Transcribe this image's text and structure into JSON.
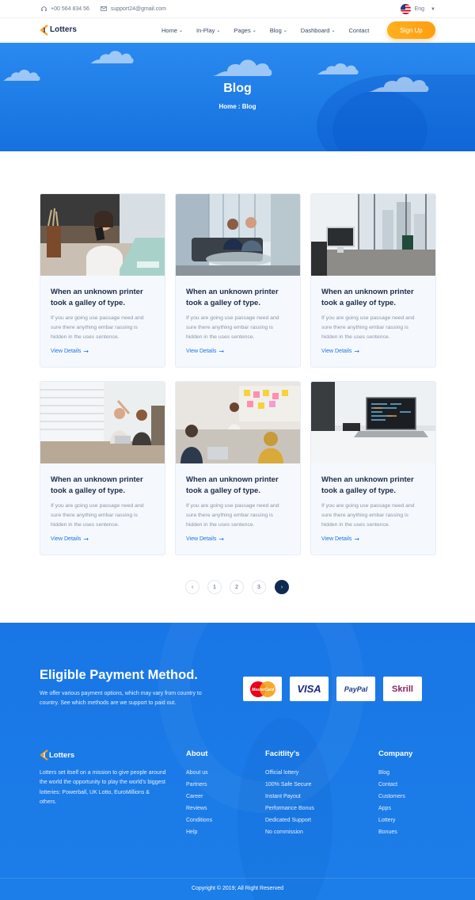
{
  "topbar": {
    "phone": "+00 564 834 56",
    "email": "support24@gmail.com",
    "language": "Eng"
  },
  "header": {
    "brand": "Lotters",
    "menu": [
      {
        "label": "Home",
        "dropdown": true
      },
      {
        "label": "In-Play",
        "dropdown": true
      },
      {
        "label": "Pages",
        "dropdown": true
      },
      {
        "label": "Blog",
        "dropdown": true
      },
      {
        "label": "Dashboard",
        "dropdown": true
      },
      {
        "label": "Contact",
        "dropdown": false
      }
    ],
    "signup_label": "Sign Up",
    "accent": "#fd9e12"
  },
  "hero": {
    "title": "Blog",
    "breadcrumb": "Home : Blog"
  },
  "posts": [
    {
      "title": "When an unknown printer took a galley of type.",
      "excerpt": "If you are going use passage need and sure there anything embar rassing is hidden in the uses sentence.",
      "link": "View Details",
      "image": "woman-phone-laptop"
    },
    {
      "title": "When an unknown printer took a galley of type.",
      "excerpt": "If you are going use passage need and sure there anything embar rassing is hidden in the uses sentence.",
      "link": "View Details",
      "image": "men-meeting-sofa"
    },
    {
      "title": "When an unknown printer took a galley of type.",
      "excerpt": "If you are going use passage need and sure there anything embar rassing is hidden in the uses sentence.",
      "link": "View Details",
      "image": "office-desk-imac"
    },
    {
      "title": "When an unknown printer took a galley of type.",
      "excerpt": "If you are going use passage need and sure there anything embar rassing is hidden in the uses sentence.",
      "link": "View Details",
      "image": "women-floor-laptop"
    },
    {
      "title": "When an unknown printer took a galley of type.",
      "excerpt": "If you are going use passage need and sure there anything embar rassing is hidden in the uses sentence.",
      "link": "View Details",
      "image": "team-sticky-notes"
    },
    {
      "title": "When an unknown printer took a galley of type.",
      "excerpt": "If you are going use passage need and sure there anything embar rassing is hidden in the uses sentence.",
      "link": "View Details",
      "image": "laptop-code-desk"
    }
  ],
  "pagination": {
    "prev": "‹",
    "pages": [
      "1",
      "2",
      "3"
    ],
    "next": "›"
  },
  "footer": {
    "payment_title": "Eligible Payment Method.",
    "payment_desc": "We offer various payment options, which may vary from country to country. See which methods are we support to paid out.",
    "payment_methods": [
      "MasterCard",
      "VISA",
      "PayPal",
      "Skrill"
    ],
    "brand": "Lotters",
    "about_text": "Lotters set itself on a mission to give people around the world the opportunity to play the world's biggest lotteries: Powerball, UK Lotto, EuroMillions & others.",
    "columns": [
      {
        "heading": "About",
        "links": [
          "About us",
          "Partners",
          "Career",
          "Reviews",
          "Conditions",
          "Help"
        ]
      },
      {
        "heading": "Facitlity's",
        "links": [
          "Official lottery",
          "100% Safe Secure",
          "Instant Payout",
          "Performance Bonus",
          "Dedicated Support",
          "No commission"
        ]
      },
      {
        "heading": "Company",
        "links": [
          "Blog",
          "Contact",
          "Customers",
          "Apps",
          "Lottery",
          "Bonues"
        ]
      }
    ],
    "copyright": "Copyright © 2019; All Right Reserved"
  }
}
